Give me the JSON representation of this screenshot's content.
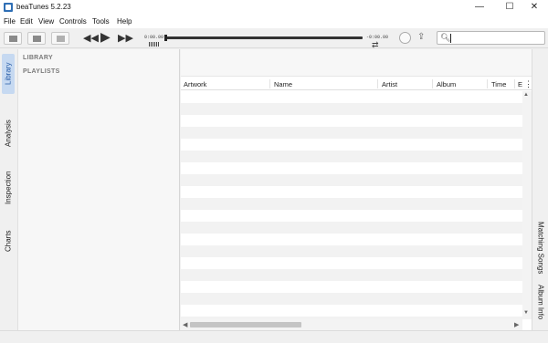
{
  "window": {
    "title": "beaTunes 5.2.23",
    "minimize": "—",
    "maximize": "☐",
    "close": "✕"
  },
  "menu": [
    "File",
    "Edit",
    "View",
    "Controls",
    "Tools",
    "Help"
  ],
  "player": {
    "elapsed": "0:00.00",
    "remaining": "-0:00.00",
    "previous_icon": "◀◀",
    "play_icon": "▶",
    "next_icon": "▶▶",
    "repeat_icon": "⇄",
    "share_icon": "⇪",
    "progress": 0.0
  },
  "search": {
    "icon": "🔍︎",
    "value": ""
  },
  "left_tabs": [
    "Library",
    "Analysis",
    "Inspection",
    "Charts"
  ],
  "sidebar": {
    "headings": [
      "LIBRARY",
      "PLAYLISTS"
    ]
  },
  "table": {
    "columns": [
      "Artwork",
      "Name",
      "Artist",
      "Album",
      "Time",
      "E"
    ],
    "menu_icon": "⋮",
    "scroll_up": "▲",
    "scroll_down": "▼",
    "scroll_left": "◀",
    "scroll_right": "▶"
  },
  "right_tabs": [
    "Matching Songs",
    "Album Info"
  ],
  "colors": {
    "active_tab_bg": "#c6d9f1",
    "active_tab_text": "#2a5ea8"
  }
}
